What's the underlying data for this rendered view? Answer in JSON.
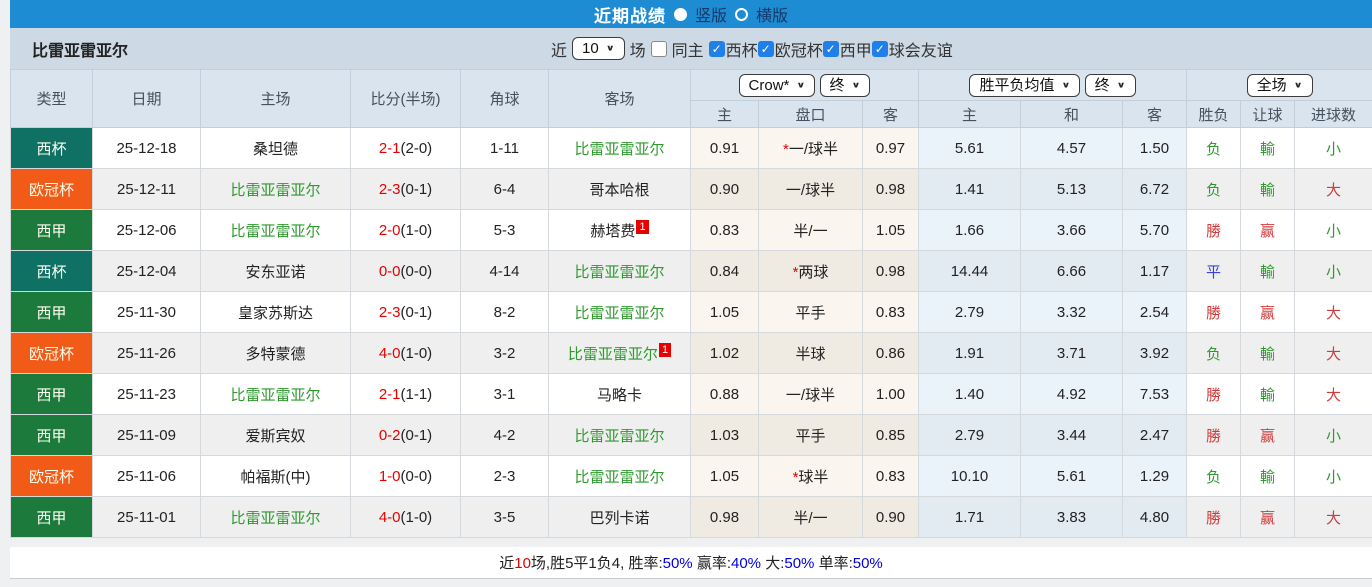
{
  "colors": {
    "topbar_bg": "#1E8CD2",
    "league_colors": {
      "西杯": "#0E7164",
      "欧冠杯": "#F15A17",
      "西甲": "#1C7A3D"
    },
    "team_green": "#2E9A2E",
    "score_red": "#E60000",
    "result_red": "#D03C3C",
    "result_green": "#2E9A2E",
    "result_blue": "#4040D8",
    "checkbox_blue": "#2080E8"
  },
  "topbar": {
    "title": "近期战绩",
    "layout_options": [
      {
        "label": "竖版",
        "selected": true
      },
      {
        "label": "横版",
        "selected": false
      }
    ]
  },
  "filterbar": {
    "team": "比雷亚雷亚尔",
    "near_label": "近",
    "count_select": "10",
    "games_label": "场",
    "same_home": {
      "label": "同主",
      "checked": false
    },
    "leagues": [
      {
        "label": "西杯",
        "checked": true
      },
      {
        "label": "欧冠杯",
        "checked": true
      },
      {
        "label": "西甲",
        "checked": true
      },
      {
        "label": "球会友谊",
        "checked": true
      }
    ]
  },
  "table": {
    "left_headers": [
      "类型",
      "日期",
      "主场",
      "比分(半场)",
      "角球",
      "客场"
    ],
    "groups": [
      {
        "selects": [
          "Crow*",
          "终"
        ],
        "cols": [
          "主",
          "盘口",
          "客"
        ]
      },
      {
        "selects": [
          "胜平负均值",
          "终"
        ],
        "cols": [
          "主",
          "和",
          "客"
        ]
      },
      {
        "selects": [
          "全场"
        ],
        "cols": [
          "胜负",
          "让球",
          "进球数"
        ]
      }
    ],
    "rows": [
      {
        "league": "西杯",
        "date": "25-12-18",
        "home": "桑坦德",
        "home_main": false,
        "home_card": "",
        "score": "2-1",
        "half": "(2-0)",
        "corner": "1-11",
        "away": "比雷亚雷亚尔",
        "away_main": true,
        "away_card": "",
        "ah_star": true,
        "ah": [
          "0.91",
          "一/球半",
          "0.97"
        ],
        "eu": [
          "5.61",
          "4.57",
          "1.50"
        ],
        "results": [
          {
            "t": "负",
            "c": "green"
          },
          {
            "t": "輸",
            "c": "green"
          },
          {
            "t": "小",
            "c": "green"
          }
        ]
      },
      {
        "league": "欧冠杯",
        "date": "25-12-11",
        "home": "比雷亚雷亚尔",
        "home_main": true,
        "home_card": "",
        "score": "2-3",
        "half": "(0-1)",
        "corner": "6-4",
        "away": "哥本哈根",
        "away_main": false,
        "away_card": "",
        "ah_star": false,
        "ah": [
          "0.90",
          "一/球半",
          "0.98"
        ],
        "eu": [
          "1.41",
          "5.13",
          "6.72"
        ],
        "results": [
          {
            "t": "负",
            "c": "green"
          },
          {
            "t": "輸",
            "c": "green"
          },
          {
            "t": "大",
            "c": "red"
          }
        ]
      },
      {
        "league": "西甲",
        "date": "25-12-06",
        "home": "比雷亚雷亚尔",
        "home_main": true,
        "home_card": "",
        "score": "2-0",
        "half": "(1-0)",
        "corner": "5-3",
        "away": "赫塔费",
        "away_main": false,
        "away_card": "1",
        "ah_star": false,
        "ah": [
          "0.83",
          "半/一",
          "1.05"
        ],
        "eu": [
          "1.66",
          "3.66",
          "5.70"
        ],
        "results": [
          {
            "t": "勝",
            "c": "red"
          },
          {
            "t": "赢",
            "c": "red"
          },
          {
            "t": "小",
            "c": "green"
          }
        ]
      },
      {
        "league": "西杯",
        "date": "25-12-04",
        "home": "安东亚诺",
        "home_main": false,
        "home_card": "",
        "score": "0-0",
        "half": "(0-0)",
        "corner": "4-14",
        "away": "比雷亚雷亚尔",
        "away_main": true,
        "away_card": "",
        "ah_star": true,
        "ah": [
          "0.84",
          "两球",
          "0.98"
        ],
        "eu": [
          "14.44",
          "6.66",
          "1.17"
        ],
        "results": [
          {
            "t": "平",
            "c": "blue"
          },
          {
            "t": "輸",
            "c": "green"
          },
          {
            "t": "小",
            "c": "green"
          }
        ]
      },
      {
        "league": "西甲",
        "date": "25-11-30",
        "home": "皇家苏斯达",
        "home_main": false,
        "home_card": "",
        "score": "2-3",
        "half": "(0-1)",
        "corner": "8-2",
        "away": "比雷亚雷亚尔",
        "away_main": true,
        "away_card": "",
        "ah_star": false,
        "ah": [
          "1.05",
          "平手",
          "0.83"
        ],
        "eu": [
          "2.79",
          "3.32",
          "2.54"
        ],
        "results": [
          {
            "t": "勝",
            "c": "red"
          },
          {
            "t": "赢",
            "c": "red"
          },
          {
            "t": "大",
            "c": "red"
          }
        ]
      },
      {
        "league": "欧冠杯",
        "date": "25-11-26",
        "home": "多特蒙德",
        "home_main": false,
        "home_card": "",
        "score": "4-0",
        "half": "(1-0)",
        "corner": "3-2",
        "away": "比雷亚雷亚尔",
        "away_main": true,
        "away_card": "1",
        "ah_star": false,
        "ah": [
          "1.02",
          "半球",
          "0.86"
        ],
        "eu": [
          "1.91",
          "3.71",
          "3.92"
        ],
        "results": [
          {
            "t": "负",
            "c": "green"
          },
          {
            "t": "輸",
            "c": "green"
          },
          {
            "t": "大",
            "c": "red"
          }
        ]
      },
      {
        "league": "西甲",
        "date": "25-11-23",
        "home": "比雷亚雷亚尔",
        "home_main": true,
        "home_card": "",
        "score": "2-1",
        "half": "(1-1)",
        "corner": "3-1",
        "away": "马略卡",
        "away_main": false,
        "away_card": "",
        "ah_star": false,
        "ah": [
          "0.88",
          "一/球半",
          "1.00"
        ],
        "eu": [
          "1.40",
          "4.92",
          "7.53"
        ],
        "results": [
          {
            "t": "勝",
            "c": "red"
          },
          {
            "t": "輸",
            "c": "green"
          },
          {
            "t": "大",
            "c": "red"
          }
        ]
      },
      {
        "league": "西甲",
        "date": "25-11-09",
        "home": "爱斯宾奴",
        "home_main": false,
        "home_card": "",
        "score": "0-2",
        "half": "(0-1)",
        "corner": "4-2",
        "away": "比雷亚雷亚尔",
        "away_main": true,
        "away_card": "",
        "ah_star": false,
        "ah": [
          "1.03",
          "平手",
          "0.85"
        ],
        "eu": [
          "2.79",
          "3.44",
          "2.47"
        ],
        "results": [
          {
            "t": "勝",
            "c": "red"
          },
          {
            "t": "赢",
            "c": "red"
          },
          {
            "t": "小",
            "c": "green"
          }
        ]
      },
      {
        "league": "欧冠杯",
        "date": "25-11-06",
        "home": "帕福斯(中)",
        "home_main": false,
        "home_card": "",
        "score": "1-0",
        "half": "(0-0)",
        "corner": "2-3",
        "away": "比雷亚雷亚尔",
        "away_main": true,
        "away_card": "",
        "ah_star": true,
        "ah": [
          "1.05",
          "球半",
          "0.83"
        ],
        "eu": [
          "10.10",
          "5.61",
          "1.29"
        ],
        "results": [
          {
            "t": "负",
            "c": "green"
          },
          {
            "t": "輸",
            "c": "green"
          },
          {
            "t": "小",
            "c": "green"
          }
        ]
      },
      {
        "league": "西甲",
        "date": "25-11-01",
        "home": "比雷亚雷亚尔",
        "home_main": true,
        "home_card": "",
        "score": "4-0",
        "half": "(1-0)",
        "corner": "3-5",
        "away": "巴列卡诺",
        "away_main": false,
        "away_card": "",
        "ah_star": false,
        "ah": [
          "0.98",
          "半/一",
          "0.90"
        ],
        "eu": [
          "1.71",
          "3.83",
          "4.80"
        ],
        "results": [
          {
            "t": "勝",
            "c": "red"
          },
          {
            "t": "赢",
            "c": "red"
          },
          {
            "t": "大",
            "c": "red"
          }
        ]
      }
    ]
  },
  "footer": {
    "segments": [
      {
        "t": "近",
        "c": "black"
      },
      {
        "t": "10",
        "c": "red"
      },
      {
        "t": "场,胜5平1负4, 胜率:",
        "c": "black"
      },
      {
        "t": "50%",
        "c": "blue"
      },
      {
        "t": " 赢率:",
        "c": "black"
      },
      {
        "t": "40%",
        "c": "blue"
      },
      {
        "t": " 大:",
        "c": "black"
      },
      {
        "t": "50%",
        "c": "blue"
      },
      {
        "t": " 单率:",
        "c": "black"
      },
      {
        "t": "50%",
        "c": "blue"
      }
    ]
  }
}
